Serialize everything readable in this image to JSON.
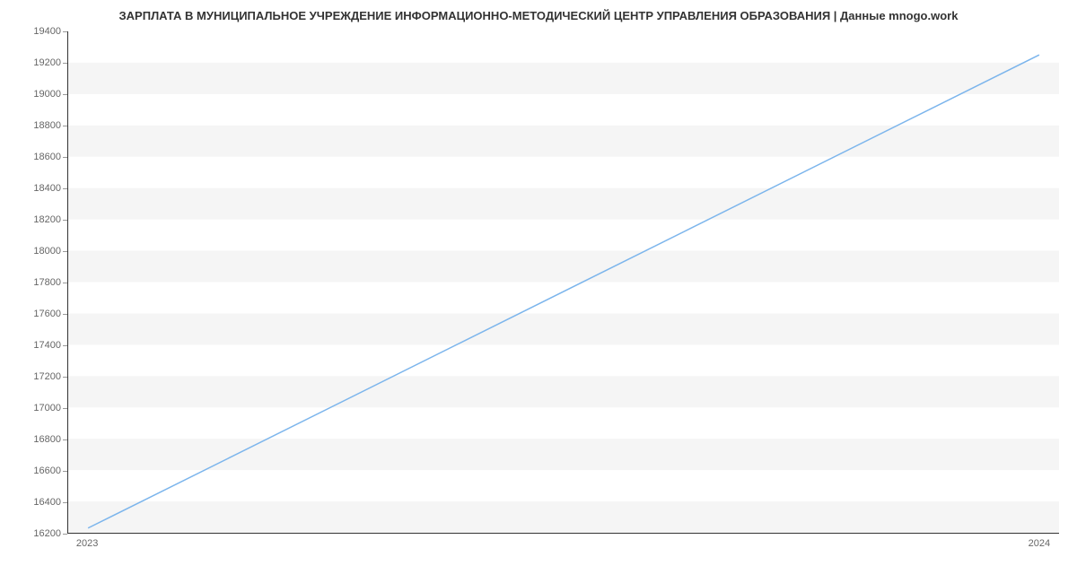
{
  "chart_data": {
    "type": "line",
    "title": "ЗАРПЛАТА В МУНИЦИПАЛЬНОЕ УЧРЕЖДЕНИЕ ИНФОРМАЦИОННО-МЕТОДИЧЕСКИЙ ЦЕНТР УПРАВЛЕНИЯ ОБРАЗОВАНИЯ | Данные mnogo.work",
    "x": [
      "2023",
      "2024"
    ],
    "values": [
      16230,
      19250
    ],
    "xlabel": "",
    "ylabel": "",
    "ylim": [
      16200,
      19400
    ],
    "y_ticks": [
      16200,
      16400,
      16600,
      16800,
      17000,
      17200,
      17400,
      17600,
      17800,
      18000,
      18200,
      18400,
      18600,
      18800,
      19000,
      19200,
      19400
    ],
    "x_ticks": [
      "2023",
      "2024"
    ],
    "line_color": "#7cb5ec",
    "grid_band_color": "#f5f5f5"
  }
}
